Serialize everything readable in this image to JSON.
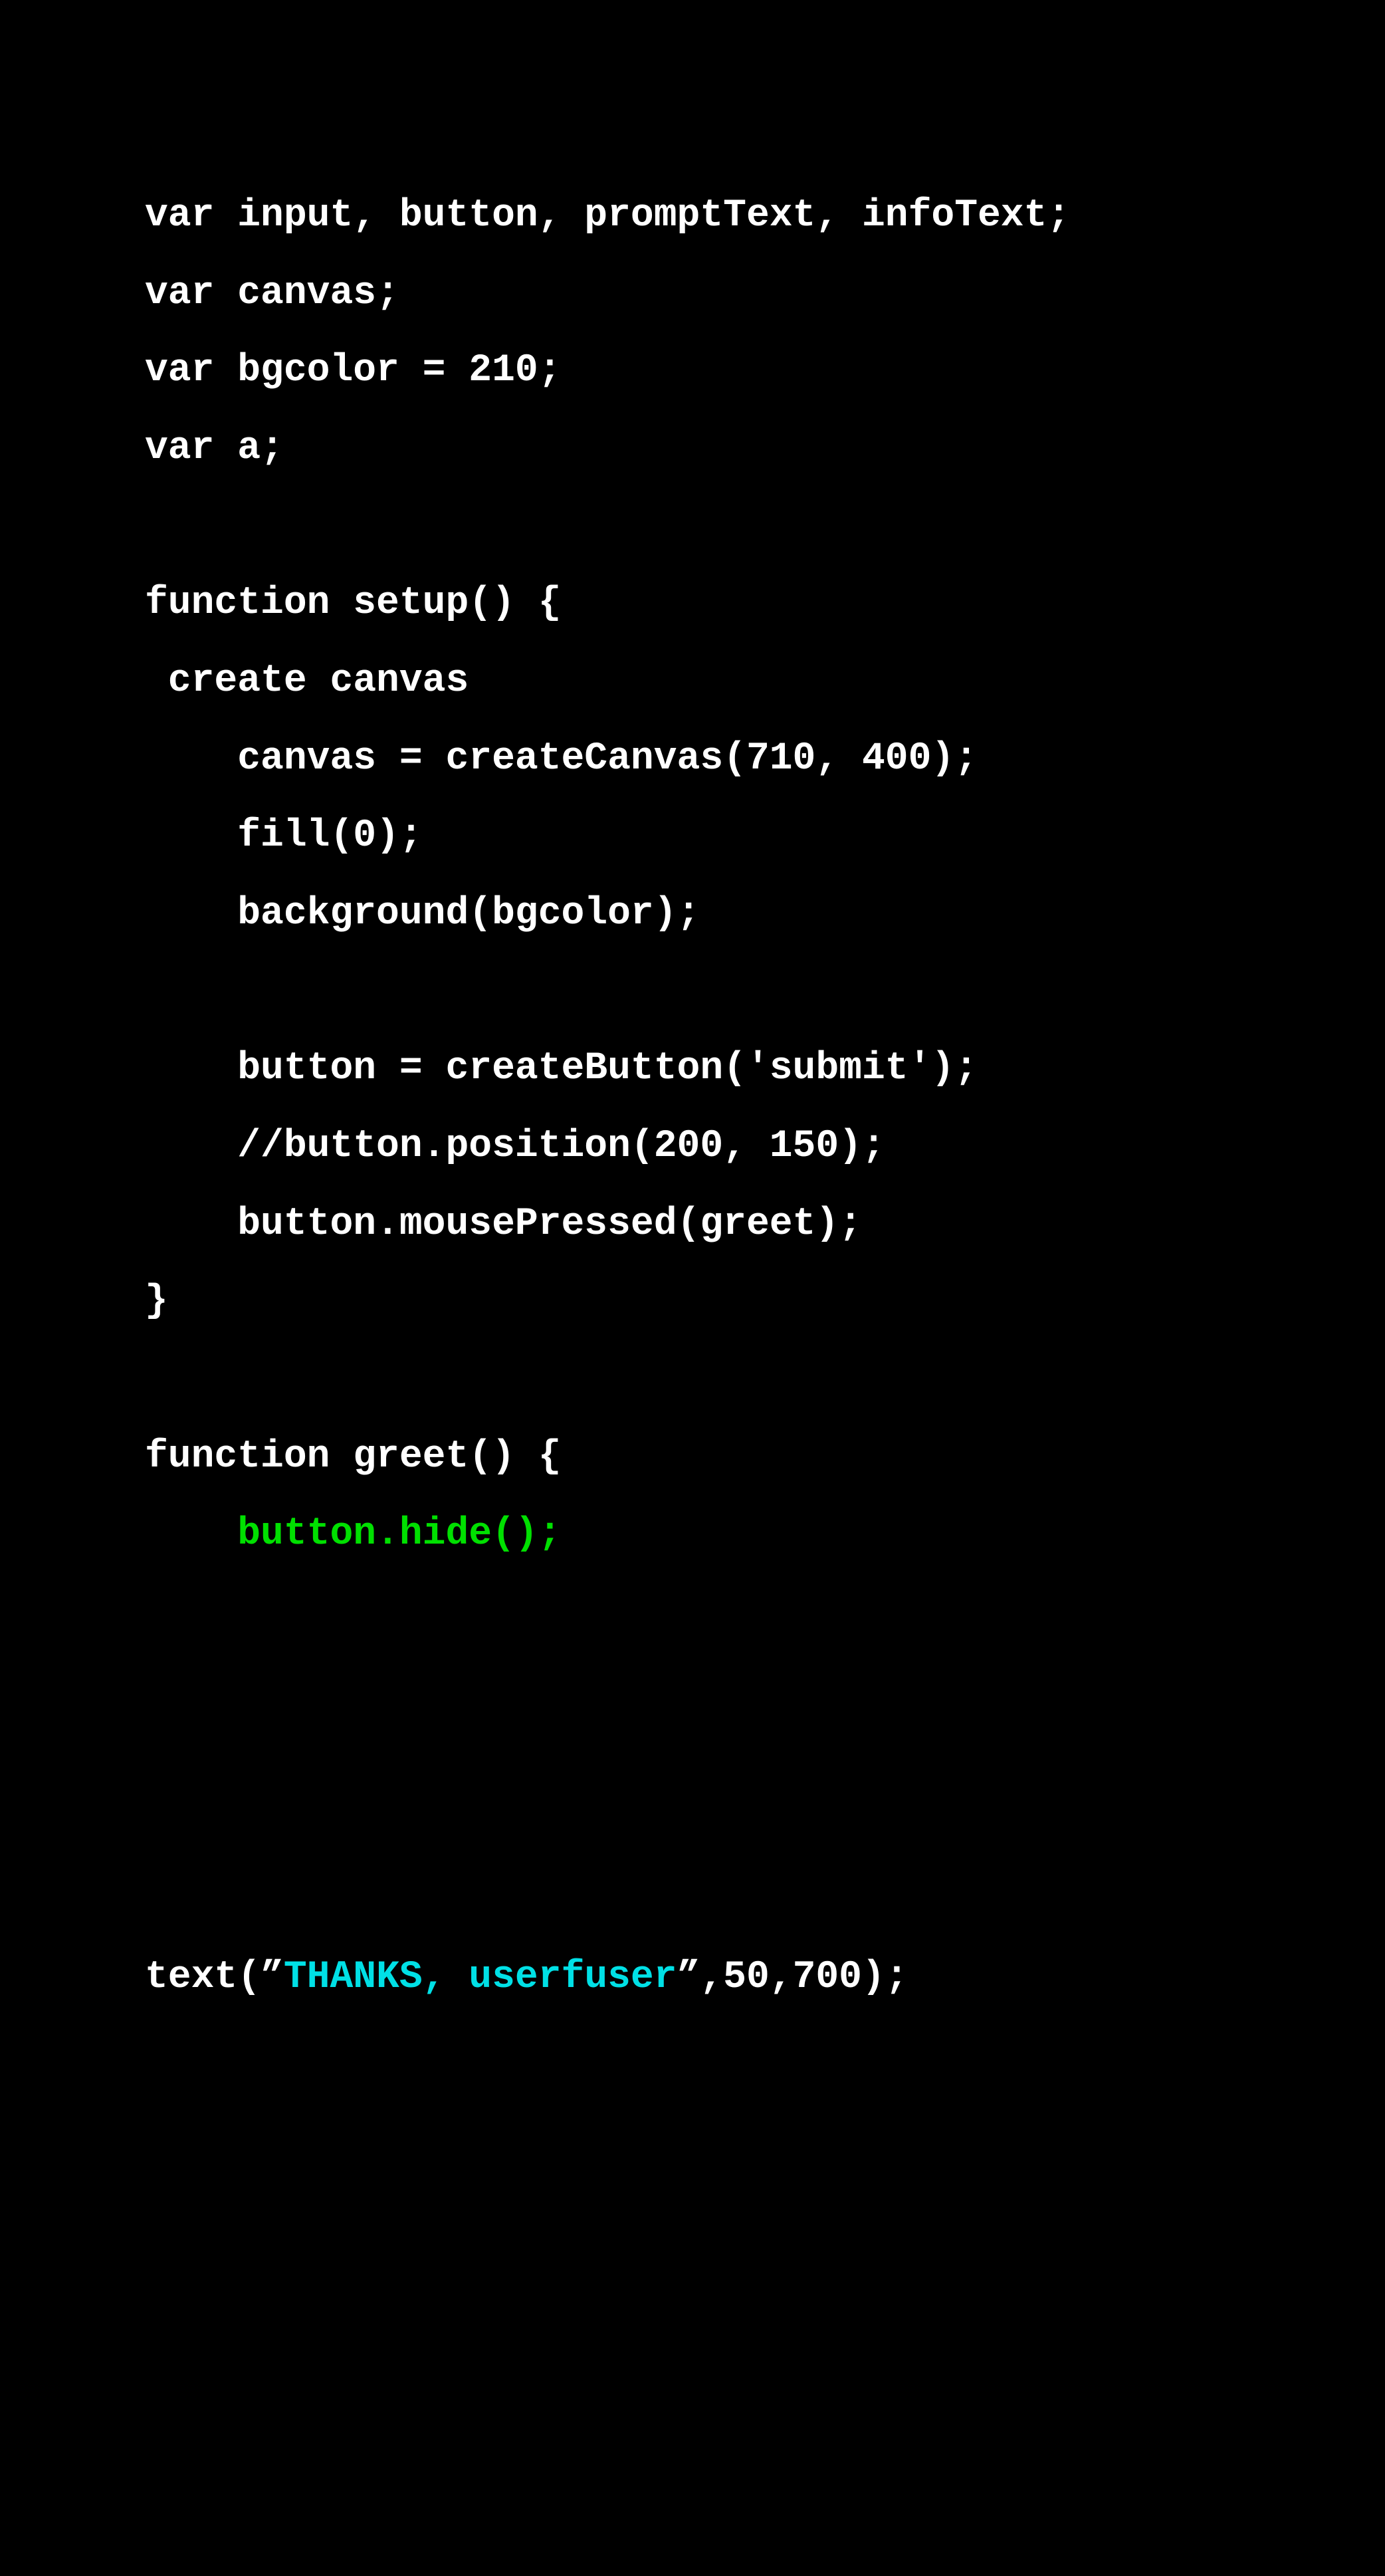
{
  "code": {
    "lines": [
      "var input, button, promptText, infoText;",
      "var canvas;",
      "var bgcolor = 210;",
      "var a;",
      "function setup() {",
      " create canvas",
      "    canvas = createCanvas(710, 400);",
      "    fill(0);",
      "    background(bgcolor);",
      "    button = createButton('submit');",
      "    //button.position(200, 150);",
      "    button.mousePressed(greet);",
      "}",
      "function greet() {",
      "    button.hide();"
    ],
    "last_line": {
      "prefix": "text(”",
      "string": "THANKS, userfuser",
      "suffix": "”,50,700);"
    }
  },
  "colors": {
    "background": "#000000",
    "default_text": "#ffffff",
    "highlight_green": "#00e000",
    "highlight_cyan": "#00e0e6"
  }
}
